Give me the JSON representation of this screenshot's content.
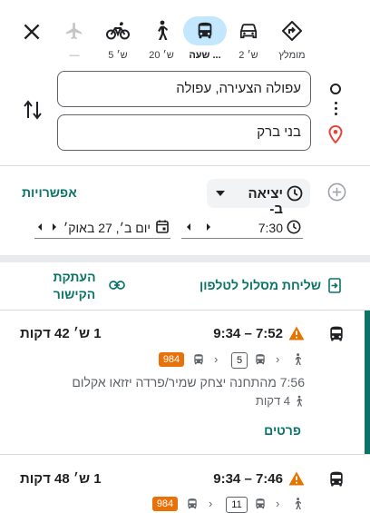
{
  "modes": [
    {
      "name": "walking-route-icon",
      "label": "מומלץ",
      "selected": false
    },
    {
      "name": "car",
      "label": "2 ש׳",
      "selected": false
    },
    {
      "name": "transit",
      "label": "שעה ...",
      "selected": true
    },
    {
      "name": "walk",
      "label": "20 ש׳",
      "selected": false
    },
    {
      "name": "bike",
      "label": "5 ש׳",
      "selected": false
    },
    {
      "name": "flight",
      "label": "—",
      "selected": false
    }
  ],
  "origin": "עפולה הצעירה, עפולה",
  "destination": "בני ברק",
  "depart_label": "יציאה ב-",
  "options_label": "אפשרויות",
  "time": "7:30",
  "date": "יום ב׳, 27 באוק׳",
  "send_to_phone": "שליחת מסלול לטלפון",
  "copy_link_line1": "העתקת",
  "copy_link_line2": "הקישור",
  "routes": [
    {
      "times": "7:52 – 9:34",
      "duration": "1 ש׳ 42 דקות",
      "bus1": "5",
      "bus2": "984",
      "from": "7:56 מהתחנה יצחק שמיר/פרדה יזזאו אקלום",
      "walk": "4 דקות",
      "details": "פרטים"
    },
    {
      "times": "7:46 – 9:34",
      "duration": "1 ש׳ 48 דקות",
      "bus1": "11",
      "bus2": "984"
    }
  ],
  "colors": {
    "accent": "#0b7466",
    "selected_mode": "#c2e7ff",
    "orange": "#e8710a",
    "warning": "#e37400",
    "pin": "#ea4335"
  }
}
